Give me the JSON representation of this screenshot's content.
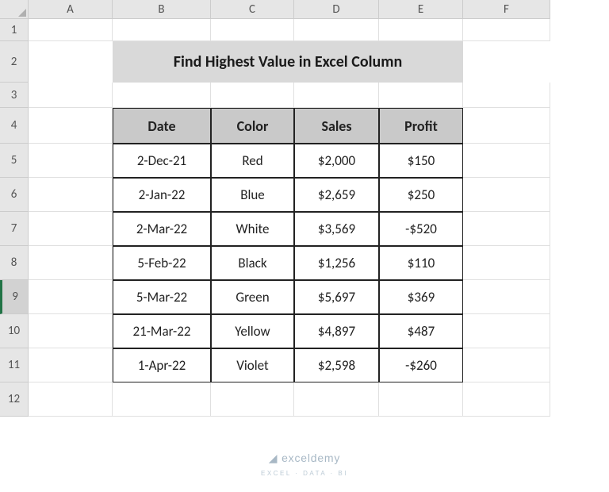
{
  "columns": [
    {
      "label": "A",
      "width": 106
    },
    {
      "label": "B",
      "width": 124
    },
    {
      "label": "C",
      "width": 105
    },
    {
      "label": "D",
      "width": 107
    },
    {
      "label": "E",
      "width": 106
    },
    {
      "label": "F",
      "width": 110
    }
  ],
  "rows": [
    {
      "label": "1",
      "height": 28
    },
    {
      "label": "2",
      "height": 52
    },
    {
      "label": "3",
      "height": 32
    },
    {
      "label": "4",
      "height": 45
    },
    {
      "label": "5",
      "height": 43
    },
    {
      "label": "6",
      "height": 43
    },
    {
      "label": "7",
      "height": 43
    },
    {
      "label": "8",
      "height": 43
    },
    {
      "label": "9",
      "height": 43,
      "selected": true
    },
    {
      "label": "10",
      "height": 43
    },
    {
      "label": "11",
      "height": 43
    },
    {
      "label": "12",
      "height": 43
    }
  ],
  "title": "Find Highest Value in Excel Column",
  "headers": [
    "Date",
    "Color",
    "Sales",
    "Profit"
  ],
  "data": [
    [
      "2-Dec-21",
      "Red",
      "$2,000",
      "$150"
    ],
    [
      "2-Jan-22",
      "Blue",
      "$2,659",
      "$250"
    ],
    [
      "2-Mar-22",
      "White",
      "$3,569",
      "-$520"
    ],
    [
      "5-Feb-22",
      "Black",
      "$1,256",
      "$110"
    ],
    [
      "5-Mar-22",
      "Green",
      "$5,697",
      "$369"
    ],
    [
      "21-Mar-22",
      "Yellow",
      "$4,897",
      "$487"
    ],
    [
      "1-Apr-22",
      "Violet",
      "$2,598",
      "-$260"
    ]
  ],
  "watermark": {
    "brand": "exceldemy",
    "tag": "EXCEL · DATA · BI"
  }
}
